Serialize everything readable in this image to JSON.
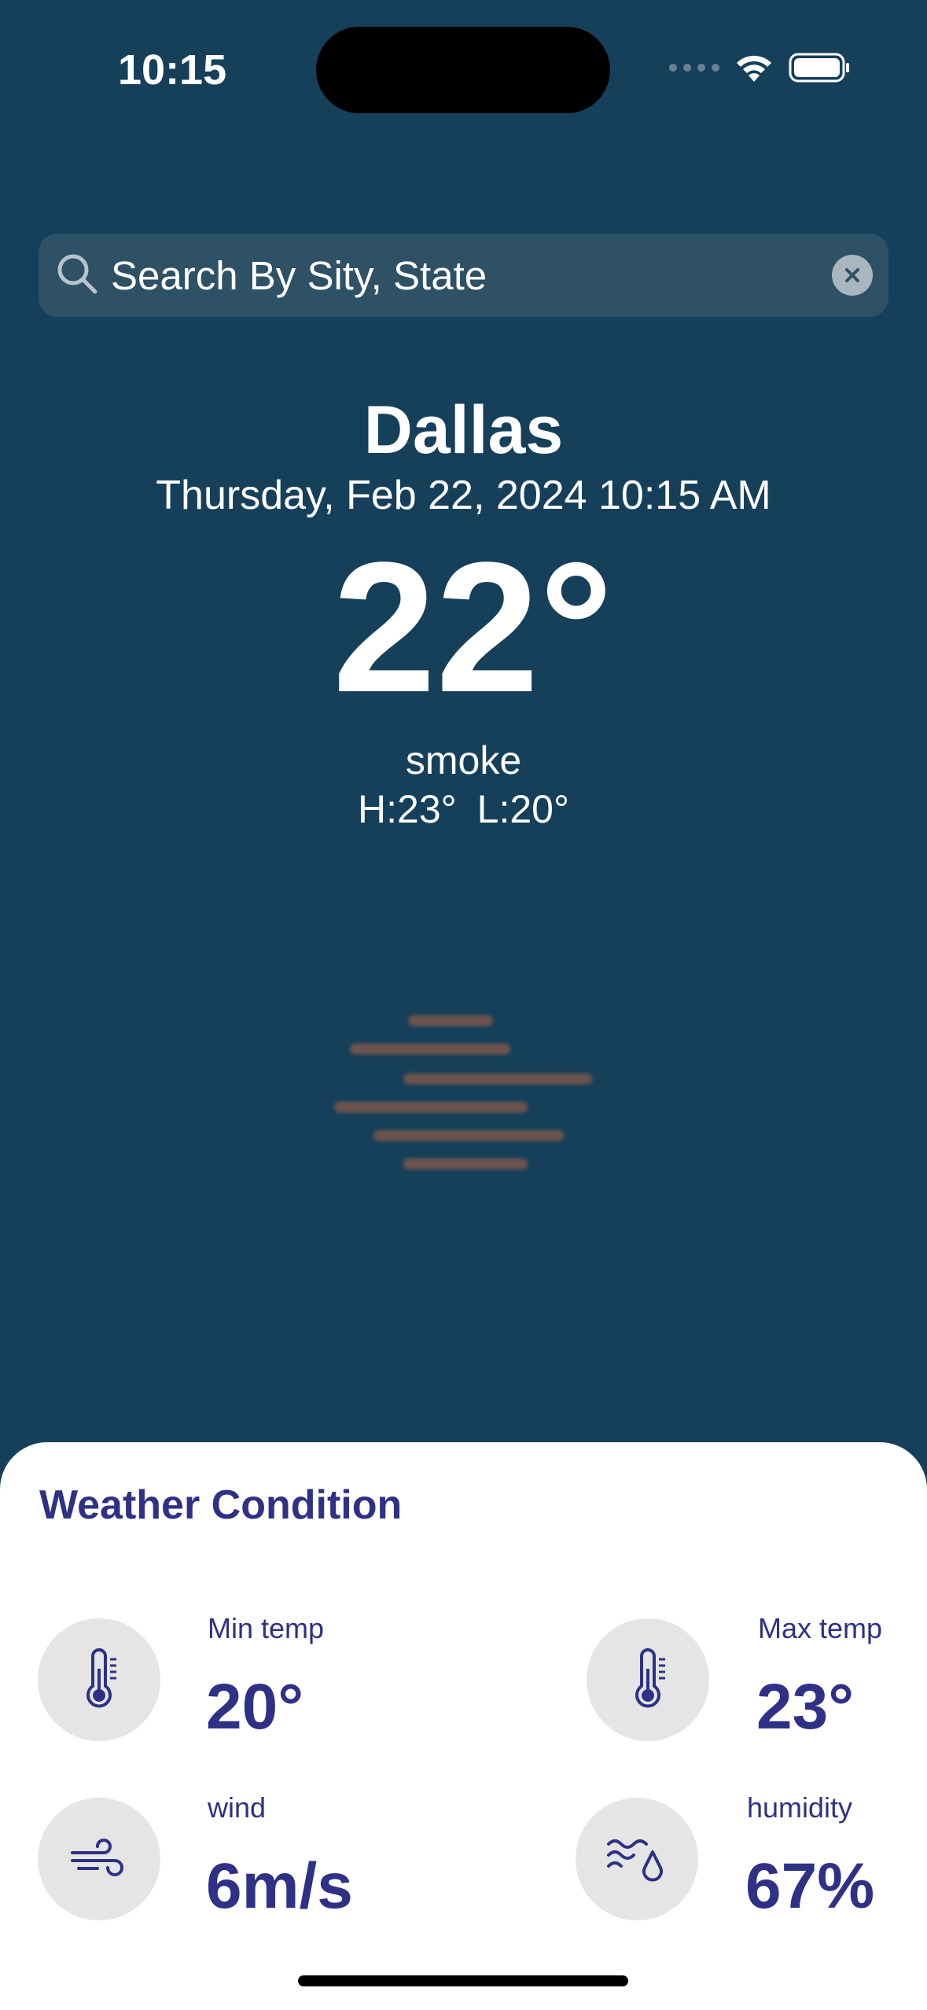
{
  "status_bar": {
    "time": "10:15"
  },
  "search": {
    "placeholder": "Search By Sity, State"
  },
  "weather": {
    "city": "Dallas",
    "datetime": "Thursday, Feb 22, 2024 10:15 AM",
    "temperature": "22°",
    "condition": "smoke",
    "high": "H:23°",
    "low": "L:20°",
    "condition_icon": "smoke-icon"
  },
  "condition_sheet": {
    "title": "Weather Condition",
    "min_temp": {
      "label": "Min temp",
      "value": "20°",
      "icon": "thermometer-icon"
    },
    "max_temp": {
      "label": "Max temp",
      "value": "23°",
      "icon": "thermometer-icon"
    },
    "wind": {
      "label": "wind",
      "value": "6m/s",
      "icon": "wind-icon"
    },
    "humidity": {
      "label": "humidity",
      "value": "67%",
      "icon": "humidity-icon"
    }
  },
  "colors": {
    "background": "#16405a",
    "search_bg": "#2f5166",
    "accent": "#2e3186",
    "icon_circle": "#e5e5e5",
    "smoke": "#8a5a4a"
  }
}
